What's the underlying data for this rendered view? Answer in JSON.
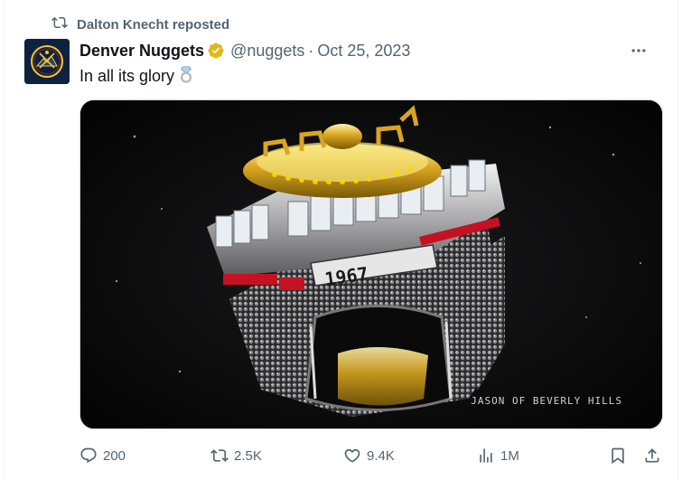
{
  "repost": {
    "icon": "repost-icon",
    "text": "Dalton Knecht reposted"
  },
  "author": {
    "name": "Denver Nuggets",
    "verified_icon": "verified-badge-icon",
    "handle": "@nuggets",
    "separator": "·",
    "date": "Oct 25, 2023",
    "avatar_icon": "denver-nuggets-logo"
  },
  "tweet": {
    "text": "In all its glory",
    "emoji_icon": "ring-emoji-icon"
  },
  "media": {
    "watermark": "JASON OF BEVERLY HILLS",
    "ring_text": "1967"
  },
  "actions": {
    "replies": "200",
    "reposts": "2.5K",
    "likes": "9.4K",
    "views": "1M"
  },
  "colors": {
    "muted": "#536471",
    "verified_gold": "#e2b719",
    "nuggets_navy": "#0e2240",
    "nuggets_gold": "#fec524"
  }
}
